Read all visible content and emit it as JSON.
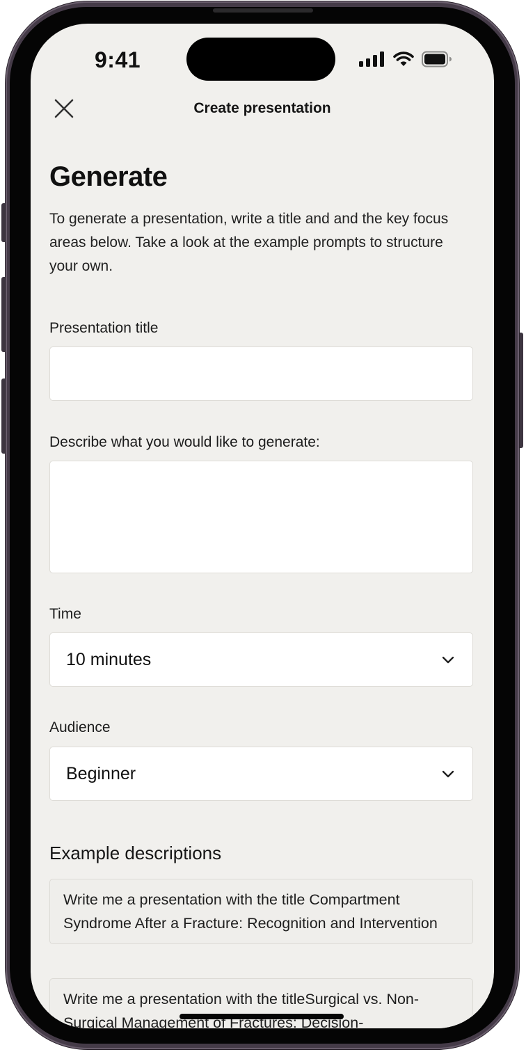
{
  "status_bar": {
    "time": "9:41",
    "icons": [
      "cellular-signal-icon",
      "wifi-icon",
      "battery-icon"
    ]
  },
  "header": {
    "title": "Create presentation",
    "close_icon": "close-icon"
  },
  "page": {
    "heading": "Generate",
    "intro": "To generate a presentation, write a title and and the key focus areas below. Take a look at the example prompts to structure your own."
  },
  "form": {
    "title_label": "Presentation title",
    "title_value": "",
    "description_label": "Describe what you would like to generate:",
    "description_value": "",
    "time_label": "Time",
    "time_value": "10 minutes",
    "audience_label": "Audience",
    "audience_value": "Beginner"
  },
  "examples": {
    "title": "Example descriptions",
    "items": [
      "Write me a presentation with the title Compartment Syndrome After a Fracture: Recognition and Intervention",
      "Write me a presentation with the titleSurgical vs. Non-Surgical Management of Fractures: Decision-"
    ]
  },
  "colors": {
    "background": "#f1f0ed",
    "field_background": "#ffffff",
    "frame": "#453b48"
  }
}
